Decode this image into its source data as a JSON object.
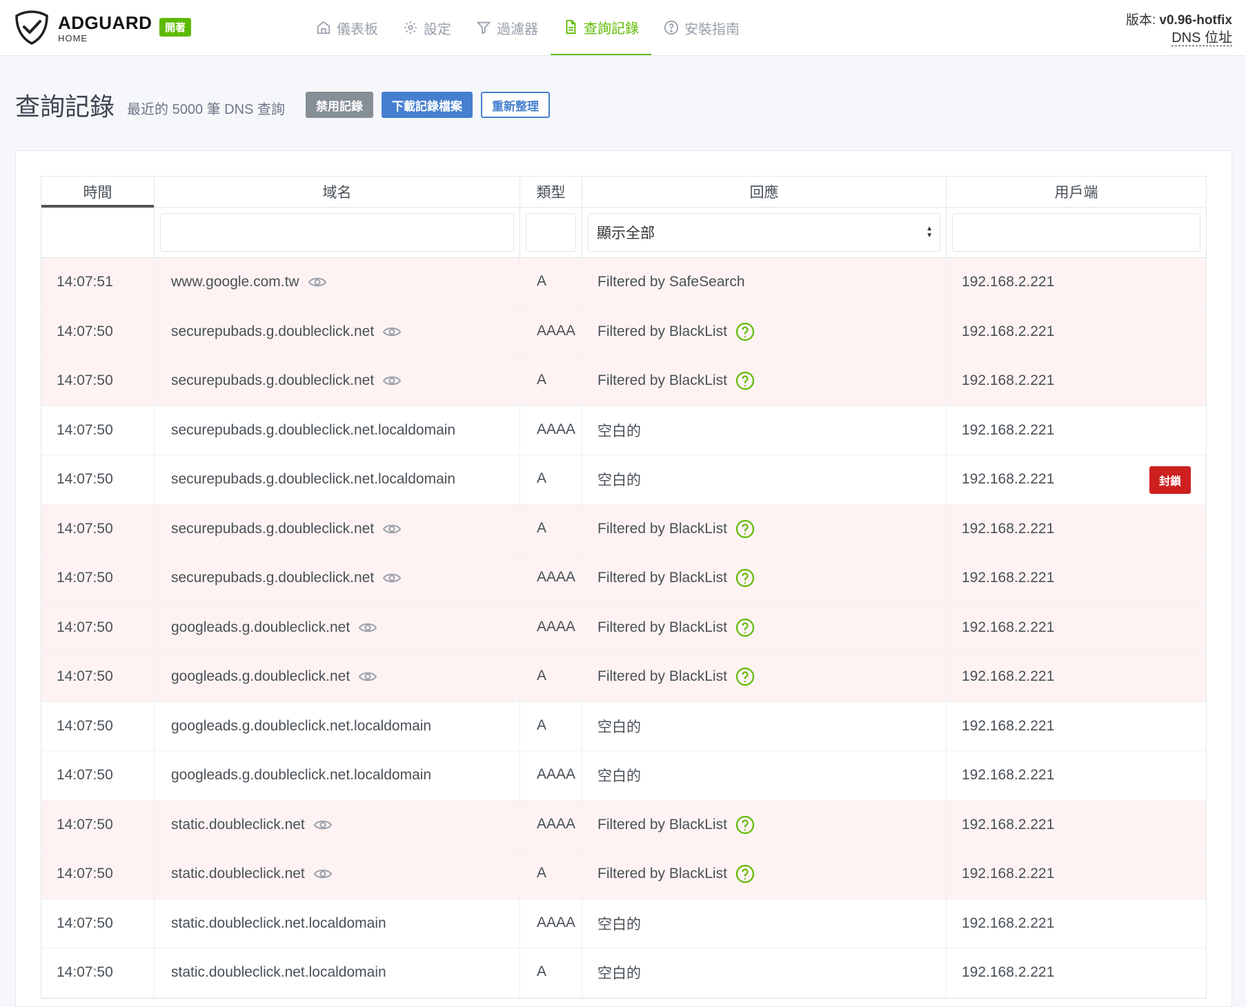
{
  "header": {
    "brand": "ADGUARD",
    "brand_sub": "HOME",
    "status_badge": "開著",
    "version_label": "版本:",
    "version_value": "v0.96-hotfix",
    "dns_link": "DNS 位址"
  },
  "nav": [
    {
      "label": "儀表板",
      "icon": "home-icon"
    },
    {
      "label": "設定",
      "icon": "gear-icon"
    },
    {
      "label": "過濾器",
      "icon": "filter-icon"
    },
    {
      "label": "查詢記錄",
      "icon": "document-icon",
      "active": true
    },
    {
      "label": "安裝指南",
      "icon": "help-circle-icon"
    }
  ],
  "page": {
    "title": "查詢記錄",
    "subtitle": "最近的 5000 筆 DNS 查詢",
    "btn_disable": "禁用記錄",
    "btn_download": "下載記錄檔案",
    "btn_refresh": "重新整理"
  },
  "table": {
    "headers": {
      "time": "時間",
      "domain": "域名",
      "type": "類型",
      "response": "回應",
      "client": "用戶端"
    },
    "filter_select": "顯示全部",
    "block_label": "封鎖",
    "rows": [
      {
        "time": "14:07:51",
        "domain": "www.google.com.tw",
        "type": "A",
        "response": "Filtered by SafeSearch",
        "client": "192.168.2.221",
        "filtered": true,
        "eye": true,
        "help": false
      },
      {
        "time": "14:07:50",
        "domain": "securepubads.g.doubleclick.net",
        "type": "AAAA",
        "response": "Filtered by BlackList",
        "client": "192.168.2.221",
        "filtered": true,
        "eye": true,
        "help": true
      },
      {
        "time": "14:07:50",
        "domain": "securepubads.g.doubleclick.net",
        "type": "A",
        "response": "Filtered by BlackList",
        "client": "192.168.2.221",
        "filtered": true,
        "eye": true,
        "help": true
      },
      {
        "time": "14:07:50",
        "domain": "securepubads.g.doubleclick.net.localdomain",
        "type": "AAAA",
        "response": "空白的",
        "client": "192.168.2.221",
        "filtered": false,
        "eye": false,
        "help": false
      },
      {
        "time": "14:07:50",
        "domain": "securepubads.g.doubleclick.net.localdomain",
        "type": "A",
        "response": "空白的",
        "client": "192.168.2.221",
        "filtered": false,
        "eye": false,
        "help": false,
        "block": true
      },
      {
        "time": "14:07:50",
        "domain": "securepubads.g.doubleclick.net",
        "type": "A",
        "response": "Filtered by BlackList",
        "client": "192.168.2.221",
        "filtered": true,
        "eye": true,
        "help": true
      },
      {
        "time": "14:07:50",
        "domain": "securepubads.g.doubleclick.net",
        "type": "AAAA",
        "response": "Filtered by BlackList",
        "client": "192.168.2.221",
        "filtered": true,
        "eye": true,
        "help": true
      },
      {
        "time": "14:07:50",
        "domain": "googleads.g.doubleclick.net",
        "type": "AAAA",
        "response": "Filtered by BlackList",
        "client": "192.168.2.221",
        "filtered": true,
        "eye": true,
        "help": true
      },
      {
        "time": "14:07:50",
        "domain": "googleads.g.doubleclick.net",
        "type": "A",
        "response": "Filtered by BlackList",
        "client": "192.168.2.221",
        "filtered": true,
        "eye": true,
        "help": true
      },
      {
        "time": "14:07:50",
        "domain": "googleads.g.doubleclick.net.localdomain",
        "type": "A",
        "response": "空白的",
        "client": "192.168.2.221",
        "filtered": false,
        "eye": false,
        "help": false
      },
      {
        "time": "14:07:50",
        "domain": "googleads.g.doubleclick.net.localdomain",
        "type": "AAAA",
        "response": "空白的",
        "client": "192.168.2.221",
        "filtered": false,
        "eye": false,
        "help": false
      },
      {
        "time": "14:07:50",
        "domain": "static.doubleclick.net",
        "type": "AAAA",
        "response": "Filtered by BlackList",
        "client": "192.168.2.221",
        "filtered": true,
        "eye": true,
        "help": true
      },
      {
        "time": "14:07:50",
        "domain": "static.doubleclick.net",
        "type": "A",
        "response": "Filtered by BlackList",
        "client": "192.168.2.221",
        "filtered": true,
        "eye": true,
        "help": true
      },
      {
        "time": "14:07:50",
        "domain": "static.doubleclick.net.localdomain",
        "type": "AAAA",
        "response": "空白的",
        "client": "192.168.2.221",
        "filtered": false,
        "eye": false,
        "help": false
      },
      {
        "time": "14:07:50",
        "domain": "static.doubleclick.net.localdomain",
        "type": "A",
        "response": "空白的",
        "client": "192.168.2.221",
        "filtered": false,
        "eye": false,
        "help": false
      }
    ]
  },
  "colors": {
    "accent": "#5eba00",
    "primary": "#467fcf",
    "danger": "#cd201f",
    "filtered_row": "#fef3f2"
  }
}
